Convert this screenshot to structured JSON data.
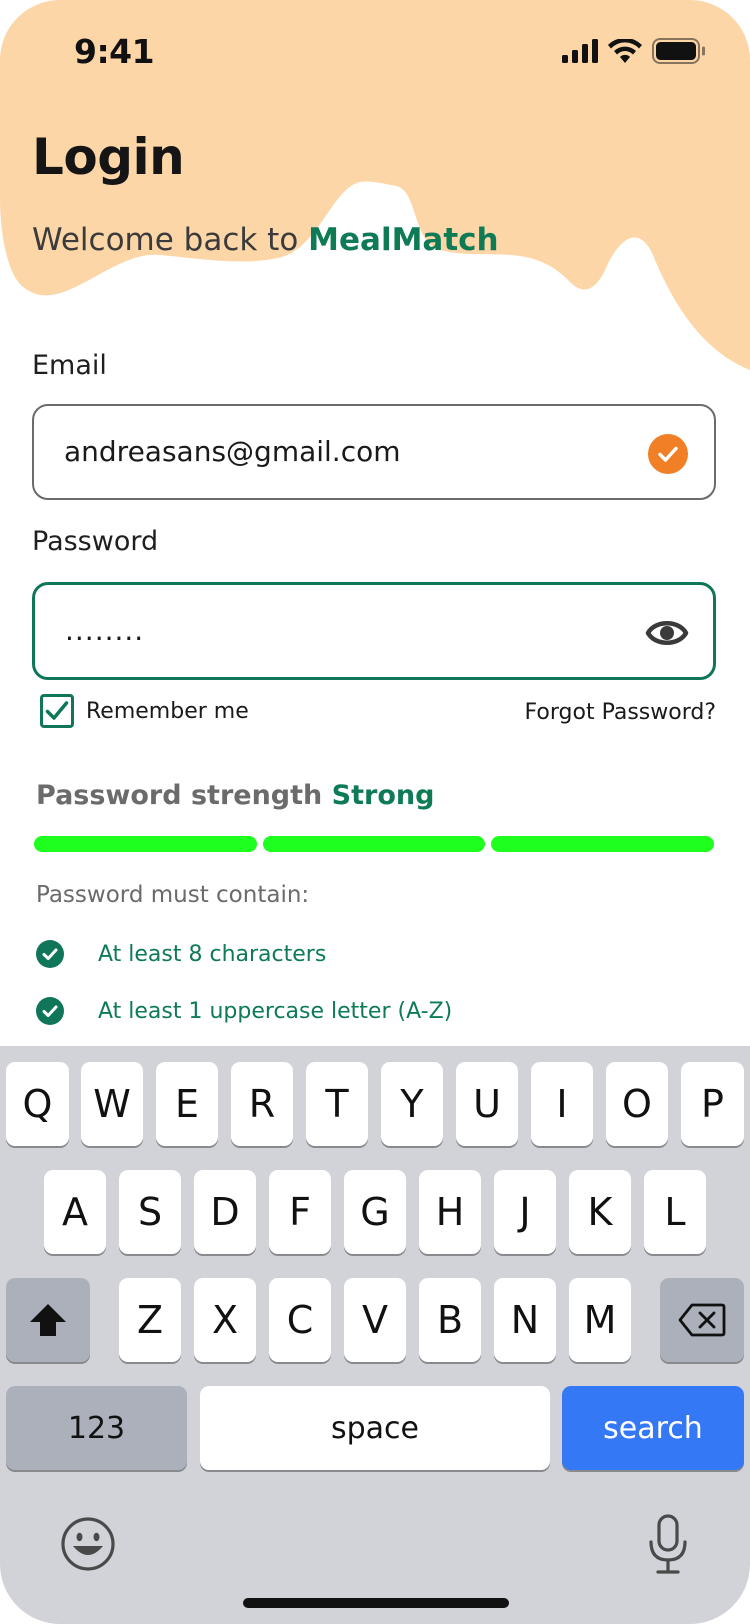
{
  "status_bar": {
    "time": "9:41"
  },
  "header": {
    "title": "Login",
    "subtitle_prefix": "Welcome back to ",
    "brand": "MealMatch"
  },
  "form": {
    "email_label": "Email",
    "email_value": "andreasans@gmail.com",
    "password_label": "Password",
    "password_value": "........",
    "remember_label": "Remember me",
    "remember_checked": true,
    "forgot_label": "Forgot Password?"
  },
  "strength": {
    "label": "Password strength ",
    "level": "Strong",
    "filled_segments": 3,
    "total_segments": 3,
    "color": "#1fff1f"
  },
  "requirements": {
    "heading": "Password must contain:",
    "items": [
      {
        "text": "At least 8 characters",
        "met": true
      },
      {
        "text": "At least 1 uppercase letter (A-Z)",
        "met": true
      }
    ]
  },
  "keyboard": {
    "row1": [
      "Q",
      "W",
      "E",
      "R",
      "T",
      "Y",
      "U",
      "I",
      "O",
      "P"
    ],
    "row2": [
      "A",
      "S",
      "D",
      "F",
      "G",
      "H",
      "J",
      "K",
      "L"
    ],
    "row3": [
      "Z",
      "X",
      "C",
      "V",
      "B",
      "N",
      "M"
    ],
    "numbers_label": "123",
    "space_label": "space",
    "action_label": "search"
  },
  "colors": {
    "accent_green": "#0e7b55",
    "blob": "#fdd6a8",
    "check_orange": "#f07f26",
    "key_blue": "#3478f6"
  }
}
